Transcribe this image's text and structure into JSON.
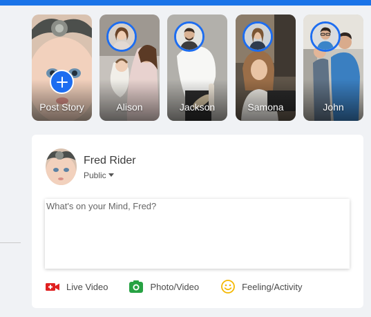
{
  "stories": [
    {
      "label": "Post Story",
      "kind": "create",
      "icon": "plus-icon"
    },
    {
      "label": "Alison",
      "kind": "story"
    },
    {
      "label": "Jackson",
      "kind": "story"
    },
    {
      "label": "Samona",
      "kind": "story"
    },
    {
      "label": "John",
      "kind": "story"
    }
  ],
  "composer": {
    "author_name": "Fred Rider",
    "privacy_label": "Public",
    "privacy_icon": "caret-down-icon",
    "placeholder": "What's on your Mind, Fred?",
    "actions": [
      {
        "label": "Live Video",
        "icon": "live-video-icon",
        "color": "#e02020"
      },
      {
        "label": "Photo/Video",
        "icon": "camera-icon",
        "color": "#27a243"
      },
      {
        "label": "Feeling/Activity",
        "icon": "smiley-icon",
        "color": "#f5b800"
      }
    ]
  },
  "colors": {
    "accent": "#1d6df0",
    "top_bar": "#1a73e8",
    "background": "#f0f2f5"
  }
}
